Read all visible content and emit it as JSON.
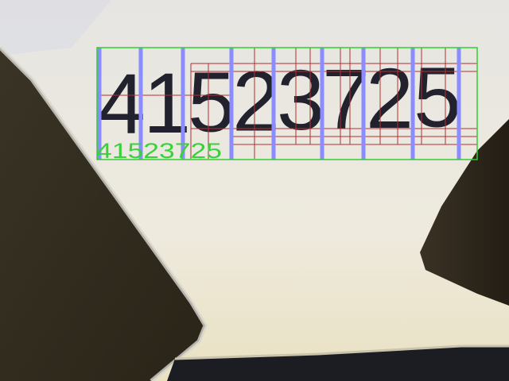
{
  "sheet": {
    "printed_number": "41523725",
    "digits": [
      "4",
      "1",
      "5",
      "2",
      "3",
      "7",
      "2",
      "5"
    ]
  },
  "overlay": {
    "recognized_text": "41523725",
    "roi_color": "#2fd02f",
    "segment_color": "#8a8cff",
    "subdivision_color": "#b03030"
  }
}
